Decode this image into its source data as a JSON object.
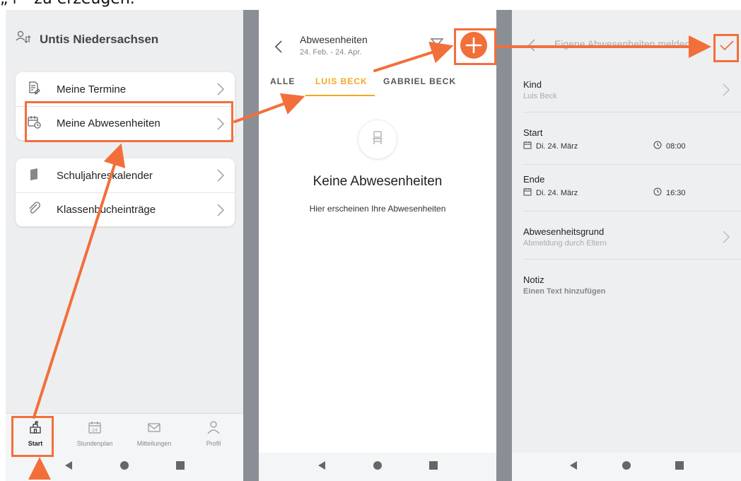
{
  "caption": "„+“ zu erzeugen.",
  "panel1": {
    "header_title": "Untis Niedersachsen",
    "menu_items": [
      "Meine Termine",
      "Meine Abwesenheiten"
    ],
    "menu_items2": [
      "Schuljahreskalender",
      "Klassenbucheinträge"
    ],
    "nav": [
      "Start",
      "Stundenplan",
      "Mitteilungen",
      "Profil"
    ],
    "calendar_day": "24"
  },
  "panel2": {
    "title": "Abwesenheiten",
    "date_range": "24. Feb. - 24. Apr.",
    "tabs": [
      "ALLE",
      "LUIS BECK",
      "GABRIEL BECK"
    ],
    "empty_title": "Keine Abwesenheiten",
    "empty_sub": "Hier erscheinen Ihre Abwesenheiten"
  },
  "panel3": {
    "title": "Eigene Abwesenheiten melden",
    "kind_label": "Kind",
    "kind_value": "Luis Beck",
    "start_label": "Start",
    "start_date": "Di. 24. März",
    "start_time": "08:00",
    "end_label": "Ende",
    "end_date": "Di. 24. März",
    "end_time": "16:30",
    "reason_label": "Abwesenheitsgrund",
    "reason_value": "Abmeldung durch Eltern",
    "note_label": "Notiz",
    "note_value": "Einen Text hinzufügen"
  },
  "colors": {
    "accent_orange": "#f26f3a",
    "tab_active": "#f5a623",
    "panel_bg": "#edeef0",
    "separator": "#8a8f95"
  }
}
